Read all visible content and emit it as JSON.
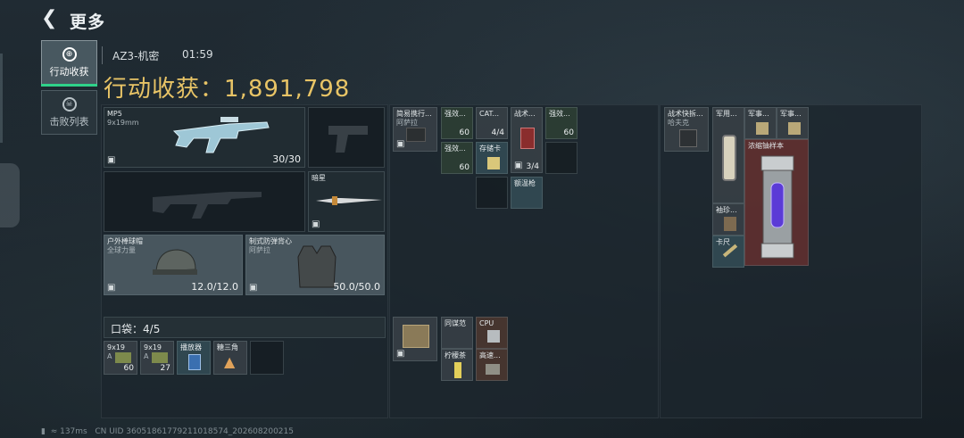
{
  "header": {
    "back_icon": "back-arrow-icon",
    "title": "更多"
  },
  "side_tabs": [
    {
      "label": "行动收获",
      "icon": "target-icon",
      "active": true
    },
    {
      "label": "击败列表",
      "icon": "skull-icon",
      "active": false
    }
  ],
  "operation": {
    "name": "AZ3-机密",
    "time": "01:59",
    "gain_label": "行动收获：",
    "gain_value": "1,891,798"
  },
  "loadout": {
    "primary": {
      "name": "MP5",
      "ammo": "9x19mm",
      "count": "30/30"
    },
    "melee": {
      "name": "暗星"
    },
    "helmet": {
      "name": "户外棒球帽",
      "sub": "全球力量",
      "durability": "12.0/12.0"
    },
    "armor": {
      "name": "制式防弹背心",
      "sub": "阿萨拉",
      "durability": "50.0/50.0"
    }
  },
  "pocket": {
    "label": "口袋：",
    "capacity": "4/5",
    "items": [
      {
        "name": "9x19",
        "sub": "A",
        "count": "60"
      },
      {
        "name": "9x19",
        "sub": "A",
        "count": "27"
      },
      {
        "name": "播放器"
      },
      {
        "name": "糖三角"
      }
    ]
  },
  "chest_rig": {
    "items": [
      {
        "name": "简易携行...",
        "sub": "阿萨拉"
      },
      {
        "name": "强效...",
        "count": "60"
      },
      {
        "name": "CAT...",
        "count": "4/4"
      },
      {
        "name": "战术...",
        "count": "3/4"
      },
      {
        "name": "强效...",
        "count": "60"
      },
      {
        "name": "强效...",
        "count": "60"
      },
      {
        "name": "存储卡"
      },
      {
        "name": "额温枪"
      }
    ]
  },
  "backpack": {
    "items": [
      {
        "name": "同谋范"
      },
      {
        "name": "CPU"
      },
      {
        "name": "柠檬茶"
      },
      {
        "name": "高速..."
      }
    ]
  },
  "safe_box": {
    "items": [
      {
        "name": "战术快拆...",
        "sub": "哈夫克"
      },
      {
        "name": "军用..."
      },
      {
        "name": "军事..."
      },
      {
        "name": "军事..."
      },
      {
        "name": "浓缩铀样本"
      },
      {
        "name": "袖珍..."
      },
      {
        "name": "卡尺"
      }
    ]
  },
  "footer": {
    "ping": "137ms",
    "uid": "CN UID 36051861779211018574_202608200215"
  },
  "colors": {
    "gain": "#e8c466",
    "active_tab_underline": "#2fd28a",
    "rare_red": "#603030"
  }
}
